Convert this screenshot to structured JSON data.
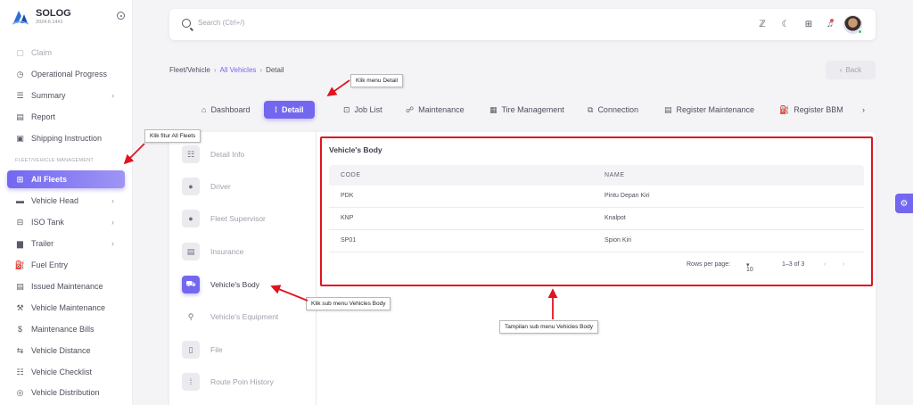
{
  "brand": {
    "name": "SOLOG",
    "version": "2024.6.14#1"
  },
  "sidebar": {
    "section_label": "FLEET/VEHICLE MANAGEMENT",
    "items": [
      {
        "label": "Claim",
        "icon": "document-icon"
      },
      {
        "label": "Operational Progress",
        "icon": "clock-icon"
      },
      {
        "label": "Summary",
        "icon": "list-icon"
      },
      {
        "label": "Report",
        "icon": "report-icon"
      },
      {
        "label": "Shipping Instruction",
        "icon": "instruction-icon"
      },
      {
        "label": "All Fleets",
        "icon": "fleet-icon"
      },
      {
        "label": "Vehicle Head",
        "icon": "vehicle-head-icon"
      },
      {
        "label": "ISO Tank",
        "icon": "tank-icon"
      },
      {
        "label": "Trailer",
        "icon": "trailer-icon"
      },
      {
        "label": "Fuel Entry",
        "icon": "fuel-icon"
      },
      {
        "label": "Issued Maintenance",
        "icon": "issued-icon"
      },
      {
        "label": "Vehicle Maintenance",
        "icon": "maintenance-icon"
      },
      {
        "label": "Maintenance Bills",
        "icon": "bills-icon"
      },
      {
        "label": "Vehicle Distance",
        "icon": "distance-icon"
      },
      {
        "label": "Vehicle Checklist",
        "icon": "checklist-icon"
      },
      {
        "label": "Vehicle Distribution",
        "icon": "distribution-icon"
      }
    ]
  },
  "search": {
    "placeholder": "Search (Ctrl+/)"
  },
  "breadcrumb": {
    "root": "Fleet/Vehicle",
    "link": "All Vehicles",
    "current": "Detail"
  },
  "back_label": "Back",
  "tabs": [
    "Dashboard",
    "Detail",
    "Job List",
    "Maintenance",
    "Tire Management",
    "Connection",
    "Register Maintenance",
    "Register BBM"
  ],
  "subnav": [
    "Detail Info",
    "Driver",
    "Fleet Supervisor",
    "Insurance",
    "Vehicle's Body",
    "Vehicle's Equipment",
    "File",
    "Route Poin History"
  ],
  "vehicle_body": {
    "title": "Vehicle's Body",
    "columns": [
      "CODE",
      "NAME"
    ],
    "rows": [
      {
        "code": "PDK",
        "name": "Pintu Depan Kiri"
      },
      {
        "code": "KNP",
        "name": "Knalpot"
      },
      {
        "code": "SP01",
        "name": "Spion Kiri"
      }
    ],
    "rows_per_page_label": "Rows per page:",
    "rows_per_page": "10",
    "range": "1–3 of 3"
  },
  "annotations": {
    "detail": "Klik menu Detail",
    "fleets": "Klik fitur All Fleets",
    "subbody": "Klik sub menu Vehicles Body",
    "display": "Tampilan sub menu Vehicles Body"
  },
  "colors": {
    "accent": "#7367f0",
    "annotation_red": "#e0141e"
  }
}
